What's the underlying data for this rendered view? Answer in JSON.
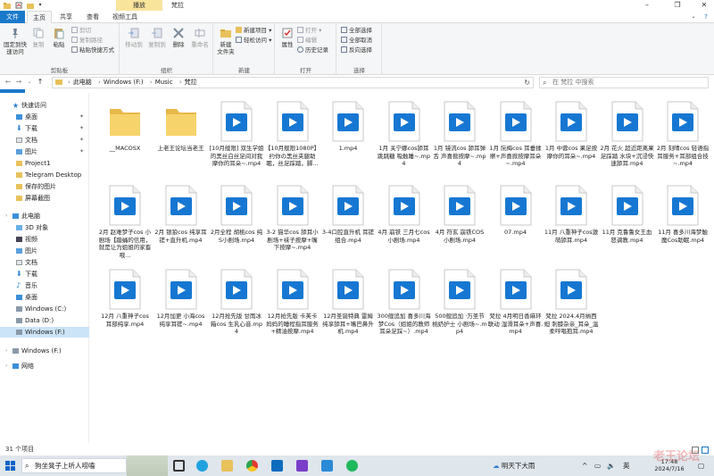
{
  "window": {
    "context_tab": "播放",
    "title": "梵拉"
  },
  "tabs": [
    "文件",
    "主页",
    "共享",
    "查看",
    "视频工具"
  ],
  "ribbon": {
    "clipboard": {
      "label": "剪贴板",
      "pin": "固定到快\n速访问",
      "copy": "复制",
      "paste": "粘贴",
      "cut": "剪切",
      "copy_path": "复制路径",
      "paste_shortcut": "粘贴快捷方式"
    },
    "organize": {
      "label": "组织",
      "move_to": "移动到",
      "copy_to": "复制到",
      "delete": "删除",
      "rename": "重命名"
    },
    "new": {
      "label": "新建",
      "new_folder": "新建\n文件夹",
      "new_item": "新建项目 ▾",
      "easy_access": "轻松访问 ▾"
    },
    "open": {
      "label": "打开",
      "properties": "属性",
      "open": "打开 ▾",
      "edit": "编辑",
      "history": "历史记录"
    },
    "select": {
      "label": "选择",
      "select_all": "全部选择",
      "select_none": "全部取消",
      "invert": "反向选择"
    }
  },
  "address": {
    "crumbs": [
      "此电脑",
      "Windows (F:)",
      "Music",
      "梵拉"
    ],
    "search_placeholder": "在 梵拉 中搜索"
  },
  "nav": {
    "quick_access": "快速访问",
    "quick_items": [
      "桌面",
      "下载",
      "文档",
      "图片",
      "Project1",
      "Telegram Desktop",
      "保存的图片",
      "屏幕截图"
    ],
    "this_pc": "此电脑",
    "pc_items": [
      "3D 对象",
      "视频",
      "图片",
      "文档",
      "下载",
      "音乐",
      "桌面",
      "Windows (C:)",
      "Data (D:)",
      "Windows (F:)"
    ],
    "drive_f": "Windows (F:)",
    "network": "网络"
  },
  "files": [
    {
      "name": "__MACOSX",
      "type": "folder"
    },
    {
      "name": "上老王论坛当老王",
      "type": "folder"
    },
    {
      "name": "[10月舰限] 双生学姐的黑丝白丝足间对我摩你的耳朵~.mp4",
      "type": "video"
    },
    {
      "name": "【10月舰限1080P】约你の黑丝夹腿助眠，丝足踩踏，脚...",
      "type": "video"
    },
    {
      "name": "1.mp4",
      "type": "video"
    },
    {
      "name": "1月 关宁娜cos舔耳 跳跳糖 吸触睡~.mp4",
      "type": "video"
    },
    {
      "name": "1月 镜流cos 舔耳弹舌 声喜掀按摩~.mp4",
      "type": "video"
    },
    {
      "name": "1月 阮梅cos 耳垂揉擦+声喜掀按摩耳朵~.mp4",
      "type": "video"
    },
    {
      "name": "1月 中蓉cos 果足按摩你的耳朵~.mp4",
      "type": "video"
    },
    {
      "name": "2月 花火 超近距离果足踩踏 水块+沉浸快速舔耳.mp4",
      "type": "video"
    },
    {
      "name": "2月 刻晴cos 轻语指耳服务+耳部组合技~.mp4",
      "type": "video"
    },
    {
      "name": "2月 赵难梦子cos 小剧场【蹦蛹的信用，就是让为姐姐的家畜哦...",
      "type": "video"
    },
    {
      "name": "2月 银狼cos 纯享耳搓+直升机.mp4",
      "type": "video"
    },
    {
      "name": "2月全程 胡桃cos 纯S小剧场.mp4",
      "type": "video"
    },
    {
      "name": "3-2 猫华cos 舔耳小剧场+袜子按摩+嘴下按摩~.mp4",
      "type": "video"
    },
    {
      "name": "3-4口腔直升机 耳搓组合.mp4",
      "type": "video"
    },
    {
      "name": "4月 崩铁 三月七cos 小剧场.mp4",
      "type": "video"
    },
    {
      "name": "4月 符玄 崩铁COS 小剧场.mp4",
      "type": "video"
    },
    {
      "name": "07.mp4",
      "type": "video"
    },
    {
      "name": "11月 八重神子cos激萌舔耳.mp4",
      "type": "video"
    },
    {
      "name": "11月 克鲁鲁女王血怒调教.mp4",
      "type": "video"
    },
    {
      "name": "11月 喜多川海梦触魔Cos助眠.mp4",
      "type": "video"
    },
    {
      "name": "12月 八重神子cos 耳部纯享.mp4",
      "type": "video"
    },
    {
      "name": "12月加更 小海cos 纯享耳搓~.mp4",
      "type": "video"
    },
    {
      "name": "12月抢先版 甘雨冰箱cos 生乳心音.mp4",
      "type": "video"
    },
    {
      "name": "12月抢先版 卡芙卡妈妈的睡程指耳服务+精油按摩.mp4",
      "type": "video"
    },
    {
      "name": "12月圣诞特典 雷姆纯享舔耳+嘴巴鼻升机.mp4",
      "type": "video"
    },
    {
      "name": "300舰追加 喜多川海梦Cos（姐姐的教师耳朵足踩~）.mp4",
      "type": "video"
    },
    {
      "name": "500舰追加 ·万圣节桃奶护士 小剧场~.mp4",
      "type": "video"
    },
    {
      "name": "梵拉 4月明日香麻环联动 湿滑耳朵+声喜.mp4",
      "type": "video"
    },
    {
      "name": "梵拉 2024.4月纳西妲 刺膝杂亲_耳朵_温柔哼唱抱耳.mp4",
      "type": "video"
    }
  ],
  "status": {
    "count": "31 个项目"
  },
  "taskbar": {
    "search_text": "狗坐凳子上听人唠嗑",
    "weather": "明天下大雨",
    "ime": "英",
    "time": "17:48",
    "date": "2024/7/16"
  },
  "watermark": "老王论坛",
  "colors": {
    "accent": "#1979ca",
    "selected": "#cce4f7",
    "folder": "#f2c94c",
    "video": "#1677d2"
  }
}
